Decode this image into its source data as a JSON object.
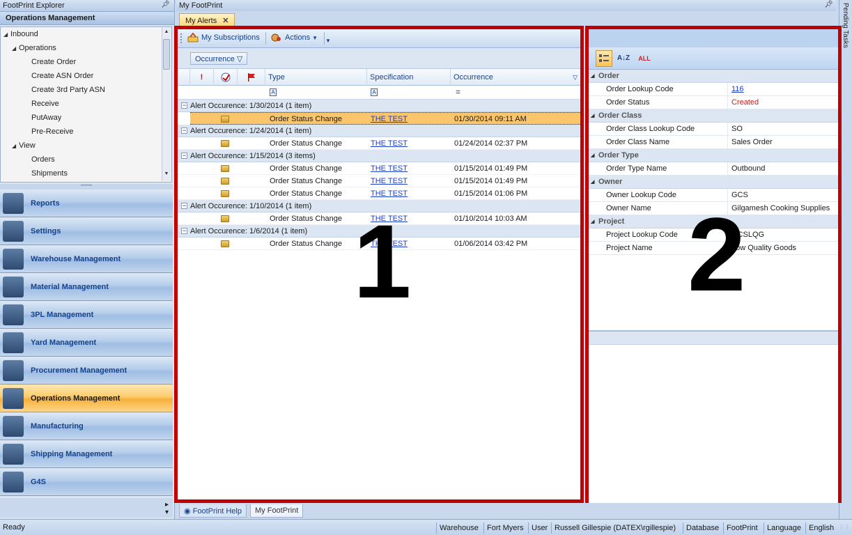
{
  "explorer": {
    "title": "FootPrint Explorer",
    "section": "Operations Management",
    "tree": [
      {
        "label": "Inbound",
        "level": 0,
        "expanded": true
      },
      {
        "label": "Operations",
        "level": 1,
        "expanded": true
      },
      {
        "label": "Create Order",
        "level": 2
      },
      {
        "label": "Create ASN Order",
        "level": 2
      },
      {
        "label": "Create 3rd Party ASN",
        "level": 2
      },
      {
        "label": "Receive",
        "level": 2
      },
      {
        "label": "PutAway",
        "level": 2
      },
      {
        "label": "Pre-Receive",
        "level": 2
      },
      {
        "label": "View",
        "level": 1,
        "expanded": true
      },
      {
        "label": "Orders",
        "level": 2
      },
      {
        "label": "Shipments",
        "level": 2
      }
    ],
    "nav": [
      {
        "label": "Reports",
        "name": "reports"
      },
      {
        "label": "Settings",
        "name": "settings"
      },
      {
        "label": "Warehouse Management",
        "name": "warehouse-management"
      },
      {
        "label": "Material Management",
        "name": "material-management"
      },
      {
        "label": "3PL Management",
        "name": "3pl-management"
      },
      {
        "label": "Yard Management",
        "name": "yard-management"
      },
      {
        "label": "Procurement Management",
        "name": "procurement-management"
      },
      {
        "label": "Operations Management",
        "name": "operations-management",
        "active": true
      },
      {
        "label": "Manufacturing",
        "name": "manufacturing"
      },
      {
        "label": "Shipping Management",
        "name": "shipping-management"
      },
      {
        "label": "G4S",
        "name": "g4s"
      }
    ]
  },
  "header": {
    "title": "My FootPrint",
    "tab_label": "My Alerts",
    "pending_tasks": "Pending Tasks"
  },
  "alerts": {
    "toolbar": {
      "subscriptions": "My Subscriptions",
      "actions": "Actions"
    },
    "group_chip": "Occurrence",
    "columns": {
      "type": "Type",
      "specification": "Specification",
      "occurrence": "Occurrence"
    },
    "filter_eq": "=",
    "groups": [
      {
        "header": "Alert Occurence: 1/30/2014 (1 item)",
        "rows": [
          {
            "type": "Order Status Change",
            "spec": "THE TEST",
            "occ": "01/30/2014 09:11 AM",
            "selected": true
          }
        ]
      },
      {
        "header": "Alert Occurence: 1/24/2014 (1 item)",
        "rows": [
          {
            "type": "Order Status Change",
            "spec": "THE TEST",
            "occ": "01/24/2014 02:37 PM"
          }
        ]
      },
      {
        "header": "Alert Occurence: 1/15/2014 (3 items)",
        "rows": [
          {
            "type": "Order Status Change",
            "spec": "THE TEST",
            "occ": "01/15/2014 01:49 PM"
          },
          {
            "type": "Order Status Change",
            "spec": "THE TEST",
            "occ": "01/15/2014 01:49 PM"
          },
          {
            "type": "Order Status Change",
            "spec": "THE TEST",
            "occ": "01/15/2014 01:06 PM"
          }
        ]
      },
      {
        "header": "Alert Occurence: 1/10/2014 (1 item)",
        "rows": [
          {
            "type": "Order Status Change",
            "spec": "THE TEST",
            "occ": "01/10/2014 10:03 AM"
          }
        ]
      },
      {
        "header": "Alert Occurence: 1/6/2014 (1 item)",
        "rows": [
          {
            "type": "Order Status Change",
            "spec": "THE TEST",
            "occ": "01/06/2014 03:42 PM"
          }
        ]
      }
    ],
    "callout": "1"
  },
  "properties": {
    "callout": "2",
    "toolbar": {
      "all_label": "ALL"
    },
    "categories": [
      {
        "name": "Order",
        "props": [
          {
            "name": "Order Lookup Code",
            "value": "116",
            "style": "link"
          },
          {
            "name": "Order Status",
            "value": "Created",
            "style": "red"
          }
        ]
      },
      {
        "name": "Order Class",
        "props": [
          {
            "name": "Order Class Lookup Code",
            "value": "SO"
          },
          {
            "name": "Order Class Name",
            "value": "Sales Order"
          }
        ]
      },
      {
        "name": "Order Type",
        "props": [
          {
            "name": "Order Type Name",
            "value": "Outbound"
          }
        ]
      },
      {
        "name": "Owner",
        "props": [
          {
            "name": "Owner Lookup Code",
            "value": "GCS"
          },
          {
            "name": "Owner Name",
            "value": "Gilgamesh Cooking Supplies"
          }
        ]
      },
      {
        "name": "Project",
        "props": [
          {
            "name": "Project Lookup Code",
            "value": "GCSLQG"
          },
          {
            "name": "Project Name",
            "value": "Low Quality Goods"
          }
        ]
      }
    ]
  },
  "bottom_tabs": [
    {
      "label": "FootPrint Help",
      "active": false
    },
    {
      "label": "My FootPrint",
      "active": true
    }
  ],
  "status": {
    "ready": "Ready",
    "warehouse_label": "Warehouse",
    "warehouse": "Fort Myers",
    "user_label": "User",
    "user": "Russell Gillespie (DATEX\\rgillespie)",
    "database_label": "Database",
    "database": "FootPrint",
    "language_label": "Language",
    "language": "English"
  },
  "colors": {
    "callout_border": "#c00000",
    "selection": "#fbc66b",
    "link": "#1a3ecc",
    "status_red": "#cc1a1a"
  }
}
